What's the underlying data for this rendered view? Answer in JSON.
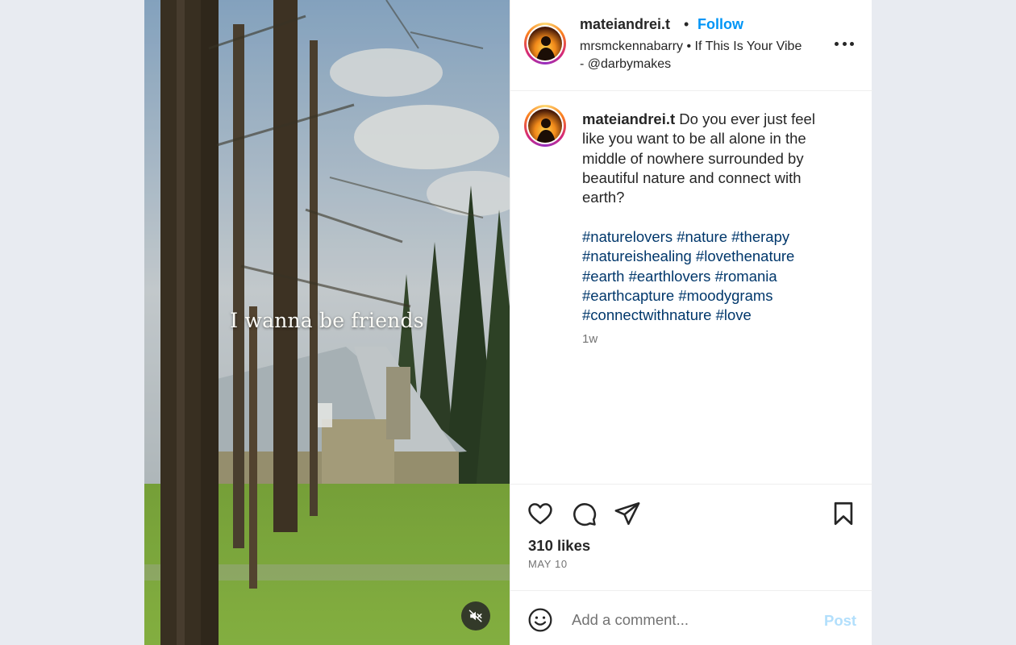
{
  "media": {
    "overlay_text": "I wanna be friends"
  },
  "header": {
    "username": "mateiandrei.t",
    "separator": "•",
    "follow_label": "Follow",
    "audio_text": "mrsmckennabarry • If This Is Your Vibe - @darbymakes"
  },
  "caption": {
    "username": "mateiandrei.t",
    "text": "Do you ever just feel like you want to be all alone in the middle of nowhere surrounded by beautiful nature and connect with earth?",
    "hashtags": [
      "#naturelovers",
      "#nature",
      "#therapy",
      "#natureishealing",
      "#lovethenature",
      "#earth",
      "#earthlovers",
      "#romania",
      "#earthcapture",
      "#moodygrams",
      "#connectwithnature",
      "#love"
    ],
    "time": "1w"
  },
  "actions": {
    "likes": "310 likes",
    "date": "MAY 10"
  },
  "comment": {
    "placeholder": "Add a comment...",
    "post_label": "Post"
  },
  "colors": {
    "accent": "#0095f6",
    "hashtag": "#00376b",
    "post_disabled": "#b2dffc"
  },
  "icons": [
    "heart-icon",
    "comment-icon",
    "share-icon",
    "bookmark-icon",
    "emoji-icon",
    "mute-icon",
    "more-icon"
  ]
}
